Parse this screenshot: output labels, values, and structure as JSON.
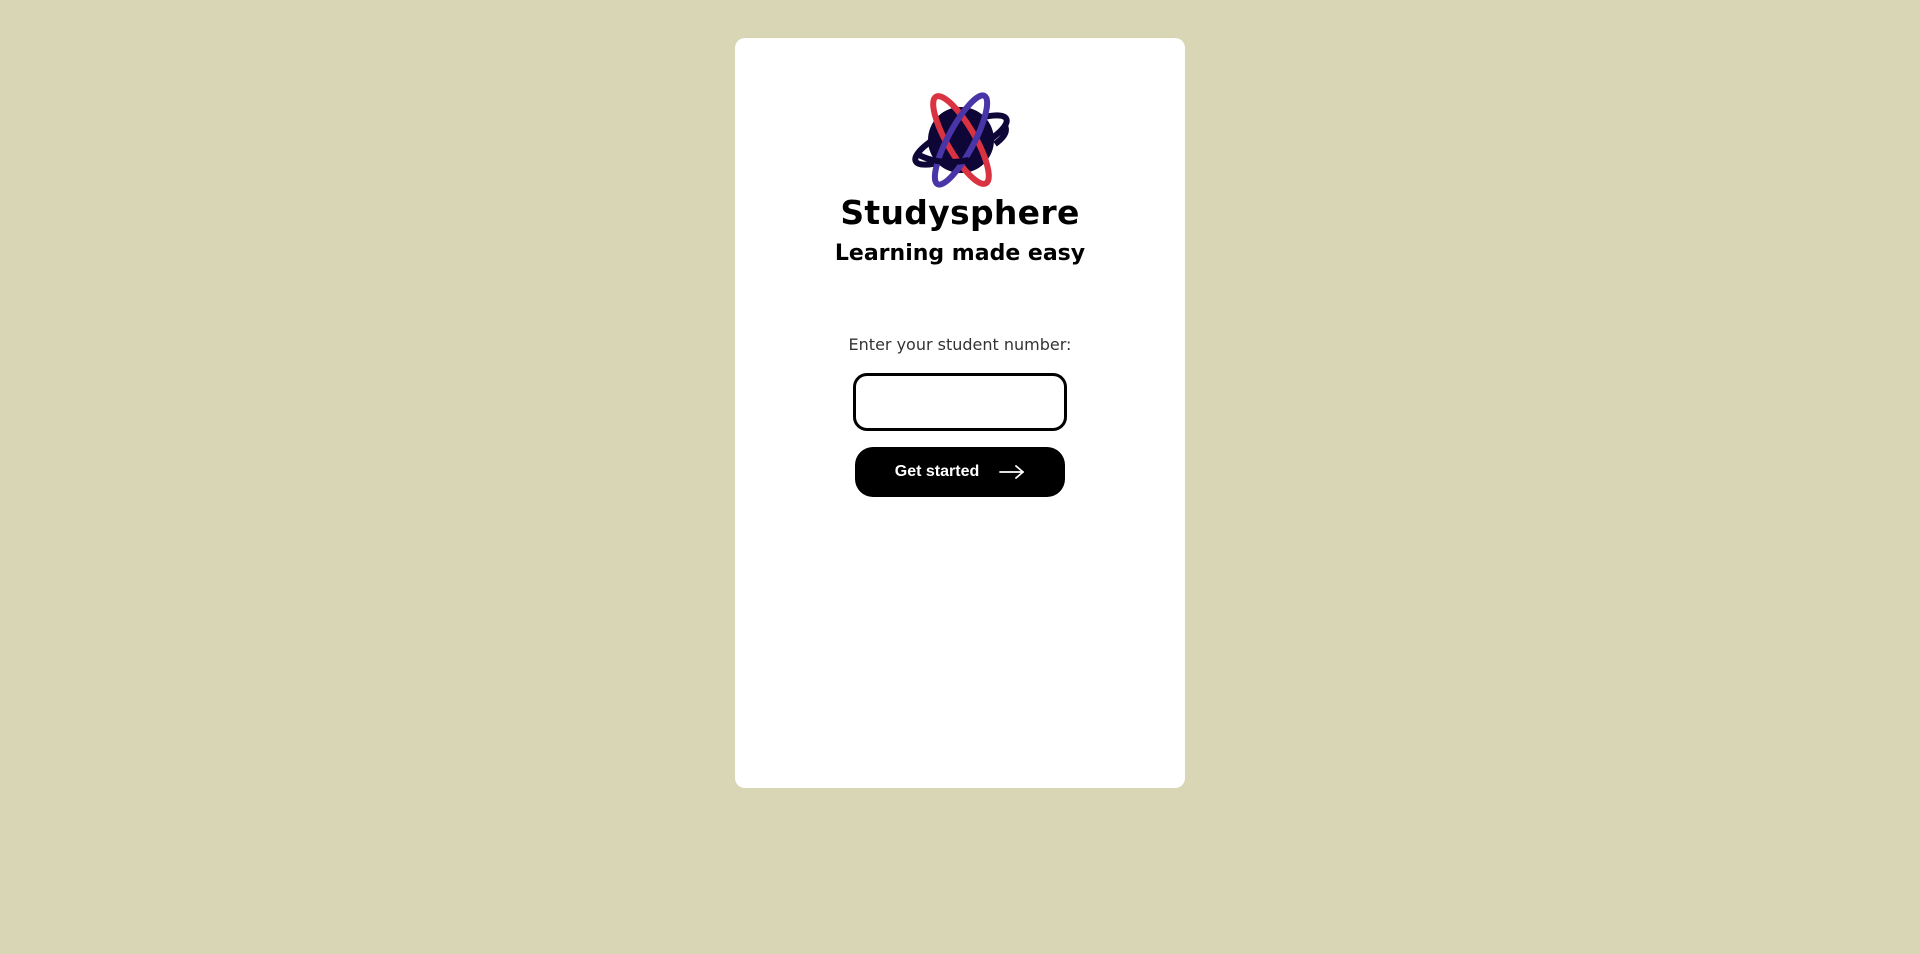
{
  "app": {
    "title": "Studysphere",
    "tagline": "Learning made easy",
    "logo_icon": "planet-icon"
  },
  "login": {
    "label": "Enter your student number:",
    "input_value": "",
    "input_placeholder": "",
    "button_label": "Get started",
    "button_icon": "arrow-right-icon"
  },
  "colors": {
    "background": "#d8d6b5",
    "card": "#ffffff",
    "button": "#000000",
    "logo_planet": "#0d0637",
    "logo_ring_red": "#d93240",
    "logo_ring_purple": "#4a35a8"
  }
}
